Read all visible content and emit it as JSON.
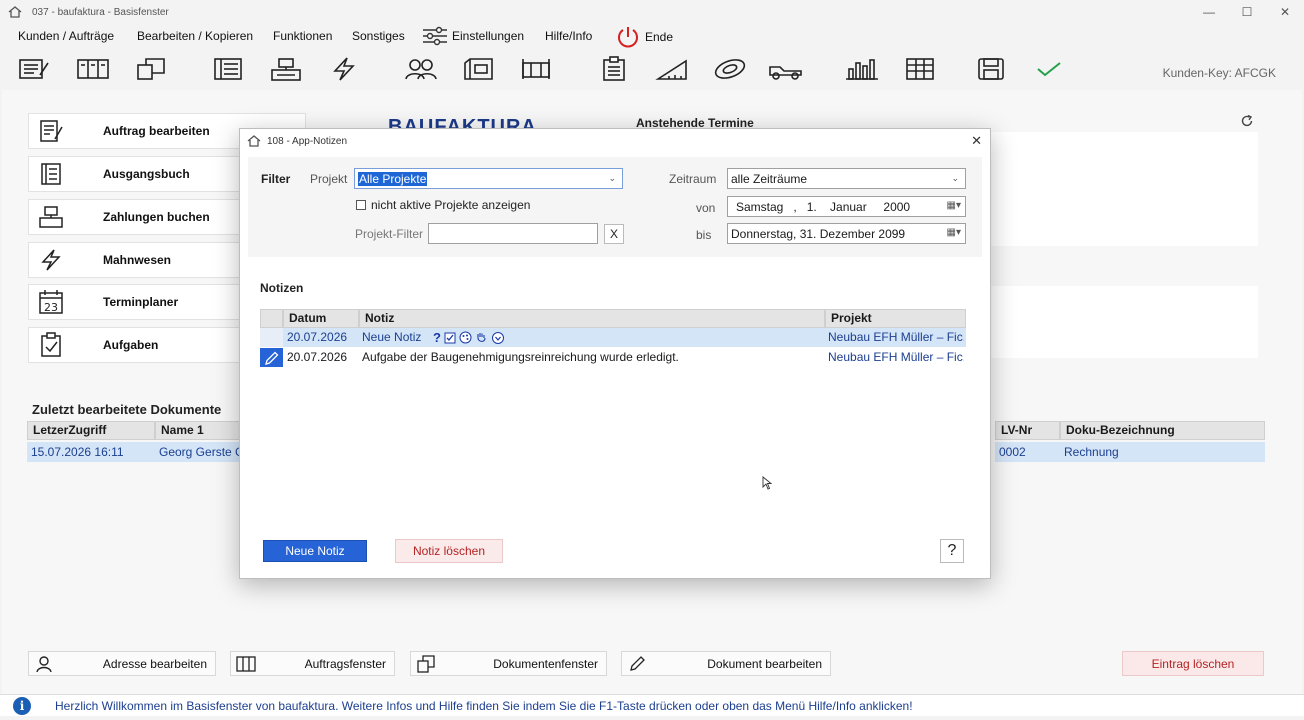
{
  "window": {
    "title": "037  -  baufaktura - Basisfenster",
    "minimize": "—",
    "maximize": "☐",
    "close": "✕"
  },
  "menu": {
    "items": [
      "Kunden / Aufträge",
      "Bearbeiten / Kopieren",
      "Funktionen",
      "Sonstiges",
      "Einstellungen",
      "Hilfe/Info",
      "Ende"
    ]
  },
  "toolbar": {
    "icons": [
      "edit-order-icon",
      "order-window-icon",
      "documents-icon",
      "ledger-icon",
      "cash-register-icon",
      "reminder-icon",
      "contacts-icon",
      "archive-icon",
      "site-icon",
      "clipboard-icon",
      "measure-icon",
      "tape-icon",
      "truck-icon",
      "chart-icon",
      "table-icon",
      "save-icon",
      "check-icon"
    ],
    "kunden_key": "Kunden-Key: AFCGK"
  },
  "left_buttons": [
    {
      "label": "Auftrag bearbeiten",
      "icon": "edit-order-icon"
    },
    {
      "label": "Ausgangsbuch",
      "icon": "ledger-icon"
    },
    {
      "label": "Zahlungen buchen",
      "icon": "cash-register-icon"
    },
    {
      "label": "Mahnwesen",
      "icon": "lightning-icon"
    },
    {
      "label": "Terminplaner",
      "icon": "calendar-icon"
    },
    {
      "label": "Aufgaben",
      "icon": "clipboard-check-icon"
    }
  ],
  "logo": "BAUFAKTURA",
  "termine": {
    "title": "Anstehende Termine"
  },
  "recent": {
    "title": "Zuletzt bearbeitete Dokumente",
    "headers": [
      "LetzerZugriff",
      "Name 1",
      "LV-Nr",
      "Doku-Bezeichnung"
    ],
    "row": {
      "zugriff": "15.07.2026 16:11",
      "name": "Georg Gerste Gr",
      "lvnr": "0002",
      "doku": "Rechnung"
    }
  },
  "bottom_buttons": [
    "Adresse bearbeiten",
    "Auftragsfenster",
    "Dokumentenfenster",
    "Dokument bearbeiten"
  ],
  "delete_entry": "Eintrag löschen",
  "status": {
    "info": "i",
    "message": "Herzlich Willkommen im Basisfenster von baufaktura. Weitere Infos und Hilfe finden Sie indem Sie die F1-Taste drücken oder oben das Menü Hilfe/Info anklicken!"
  },
  "dialog": {
    "title": "108  -  App-Notizen",
    "close": "✕",
    "filter_label": "Filter",
    "projekt_label": "Projekt",
    "projekt_value": "Alle Projekte",
    "inactive_label": "nicht aktive Projekte anzeigen",
    "projekt_filter_label": "Projekt-Filter",
    "projekt_filter_value": "",
    "x_label": "X",
    "zeitraum_label": "Zeitraum",
    "zeitraum_value": "alle Zeiträume",
    "von_label": "von",
    "von_value": "Samstag   ,   1.    Januar     2000",
    "bis_label": "bis",
    "bis_value": "Donnerstag, 31. Dezember 2099",
    "notes_title": "Notizen",
    "headers": [
      "Datum",
      "Notiz",
      "Projekt"
    ],
    "rows": [
      {
        "datum": "20.07.2026",
        "notiz": "Neue Notiz",
        "projekt": "Neubau EFH Müller – Fic..."
      },
      {
        "datum": "20.07.2026",
        "notiz": "Aufgabe der Baugenehmigungsreinreichung wurde erledigt.",
        "projekt": "Neubau EFH Müller – Fic..."
      }
    ],
    "row_tools": "?",
    "btn_new": "Neue Notiz",
    "btn_delete": "Notiz löschen",
    "btn_help": "?"
  }
}
